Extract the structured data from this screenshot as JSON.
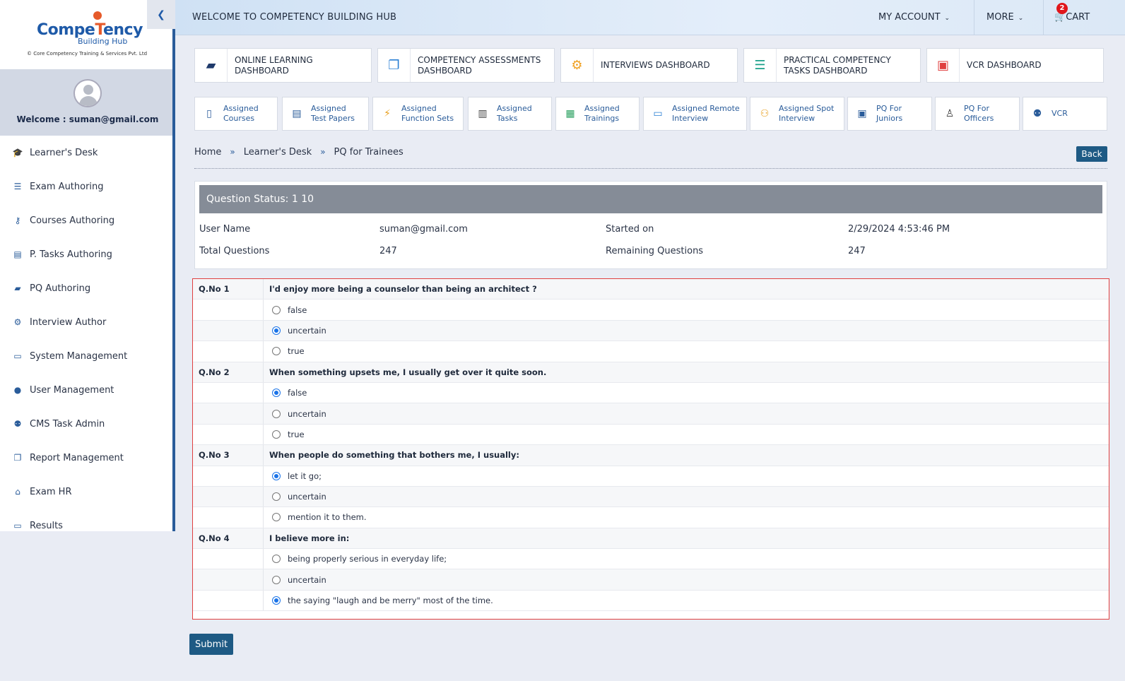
{
  "brand": {
    "logo_text_a": "Compe",
    "logo_text_b": "T",
    "logo_text_c": "ency",
    "logo_sub": "Building Hub",
    "logo_fine": "© Core Competency Training & Services Pvt. Ltd"
  },
  "profile": {
    "welcome": "Welcome : suman@gmail.com"
  },
  "sidebar": {
    "items": [
      {
        "label": "Learner's Desk",
        "icon": "graduation-cap-icon"
      },
      {
        "label": "Exam Authoring",
        "icon": "list-icon"
      },
      {
        "label": "Courses Authoring",
        "icon": "sitemap-icon"
      },
      {
        "label": "P. Tasks Authoring",
        "icon": "tasks-icon"
      },
      {
        "label": "PQ Authoring",
        "icon": "book-icon"
      },
      {
        "label": "Interview Author",
        "icon": "cogs-icon"
      },
      {
        "label": "System Management",
        "icon": "monitor-icon"
      },
      {
        "label": "User Management",
        "icon": "user-icon"
      },
      {
        "label": "CMS Task Admin",
        "icon": "user-cog-icon"
      },
      {
        "label": "Report Management",
        "icon": "copy-icon"
      },
      {
        "label": "Exam HR",
        "icon": "bank-icon"
      },
      {
        "label": "Results",
        "icon": "monitor-icon"
      }
    ]
  },
  "topbar": {
    "welcome": "WELCOME TO COMPETENCY BUILDING HUB",
    "my_account": "MY ACCOUNT",
    "more": "MORE",
    "cart": "CART",
    "cart_count": "2"
  },
  "dashboards": [
    {
      "line1": "ONLINE LEARNING",
      "line2": "DASHBOARD",
      "icon_color": "#1f3a6b"
    },
    {
      "line1": "COMPETENCY ASSESSMENTS",
      "line2": "DASHBOARD",
      "icon_color": "#2a7fd4"
    },
    {
      "line1": "INTERVIEWS DASHBOARD",
      "line2": "",
      "icon_color": "#f0a020"
    },
    {
      "line1": "PRACTICAL COMPETENCY",
      "line2": "TASKS DASHBOARD",
      "icon_color": "#1aa08a"
    },
    {
      "line1": "VCR DASHBOARD",
      "line2": "",
      "icon_color": "#e04040"
    }
  ],
  "assigned": [
    {
      "line1": "Assigned",
      "line2": "Courses"
    },
    {
      "line1": "Assigned",
      "line2": "Test Papers"
    },
    {
      "line1": "Assigned",
      "line2": "Function Sets"
    },
    {
      "line1": "Assigned",
      "line2": "Tasks"
    },
    {
      "line1": "Assigned",
      "line2": "Trainings"
    },
    {
      "line1": "Assigned Remote",
      "line2": "Interview"
    },
    {
      "line1": "Assigned Spot",
      "line2": "Interview"
    },
    {
      "line1": "PQ For",
      "line2": "Juniors"
    },
    {
      "line1": "PQ For",
      "line2": "Officers"
    },
    {
      "line1": "VCR",
      "line2": ""
    }
  ],
  "breadcrumb": {
    "home": "Home",
    "desk": "Learner's Desk",
    "current": "PQ for Trainees",
    "sep": "»"
  },
  "back_label": "Back",
  "status": {
    "header": "Question Status: 1 10",
    "user_name_label": "User Name",
    "user_name": "suman@gmail.com",
    "started_label": "Started on",
    "started": "2/29/2024 4:53:46 PM",
    "total_label": "Total Questions",
    "total": "247",
    "remaining_label": "Remaining Questions",
    "remaining": "247"
  },
  "questions": [
    {
      "no": "Q.No 1",
      "text": "I'd enjoy more being a counselor than being an architect ?",
      "options": [
        {
          "label": "false",
          "selected": false
        },
        {
          "label": "uncertain",
          "selected": true
        },
        {
          "label": "true",
          "selected": false
        }
      ]
    },
    {
      "no": "Q.No 2",
      "text": "When something upsets me, I usually get over it quite soon.",
      "options": [
        {
          "label": "false",
          "selected": true
        },
        {
          "label": "uncertain",
          "selected": false
        },
        {
          "label": "true",
          "selected": false
        }
      ]
    },
    {
      "no": "Q.No 3",
      "text": "When people do something that bothers me, I usually:",
      "options": [
        {
          "label": "let it go;",
          "selected": true
        },
        {
          "label": "uncertain",
          "selected": false
        },
        {
          "label": "mention it to them.",
          "selected": false
        }
      ]
    },
    {
      "no": "Q.No 4",
      "text": "I believe more in:",
      "options": [
        {
          "label": "being properly serious in everyday life;",
          "selected": false
        },
        {
          "label": "uncertain",
          "selected": false
        },
        {
          "label": "the saying \"laugh and be merry\" most of the time.",
          "selected": true
        }
      ]
    }
  ],
  "submit_label": "Submit"
}
